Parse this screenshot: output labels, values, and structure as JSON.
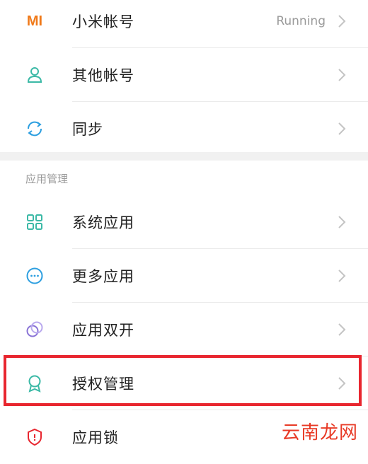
{
  "account_group": {
    "items": [
      {
        "label": "小米帐号",
        "value": "Running",
        "icon": "mi-logo-icon",
        "icon_color": "#f07a1a"
      },
      {
        "label": "其他帐号",
        "icon": "person-icon",
        "icon_color": "#3bb9a6"
      },
      {
        "label": "同步",
        "icon": "sync-icon",
        "icon_color": "#2d9fe0"
      }
    ]
  },
  "app_management": {
    "header": "应用管理",
    "items": [
      {
        "label": "系统应用",
        "icon": "grid-icon",
        "icon_color": "#3bb9a6"
      },
      {
        "label": "更多应用",
        "icon": "more-dots-icon",
        "icon_color": "#2d9fe0"
      },
      {
        "label": "应用双开",
        "icon": "dual-app-icon",
        "icon_color": "#8a74d6"
      },
      {
        "label": "授权管理",
        "icon": "ribbon-award-icon",
        "icon_color": "#3bb9a6"
      },
      {
        "label": "应用锁",
        "icon": "shield-lock-icon",
        "icon_color": "#e8262f"
      }
    ]
  },
  "watermark": "云南龙网",
  "colors": {
    "highlight_border": "#e8262f",
    "chevron": "#c4c4c4",
    "section_band": "#f1f1f1"
  }
}
